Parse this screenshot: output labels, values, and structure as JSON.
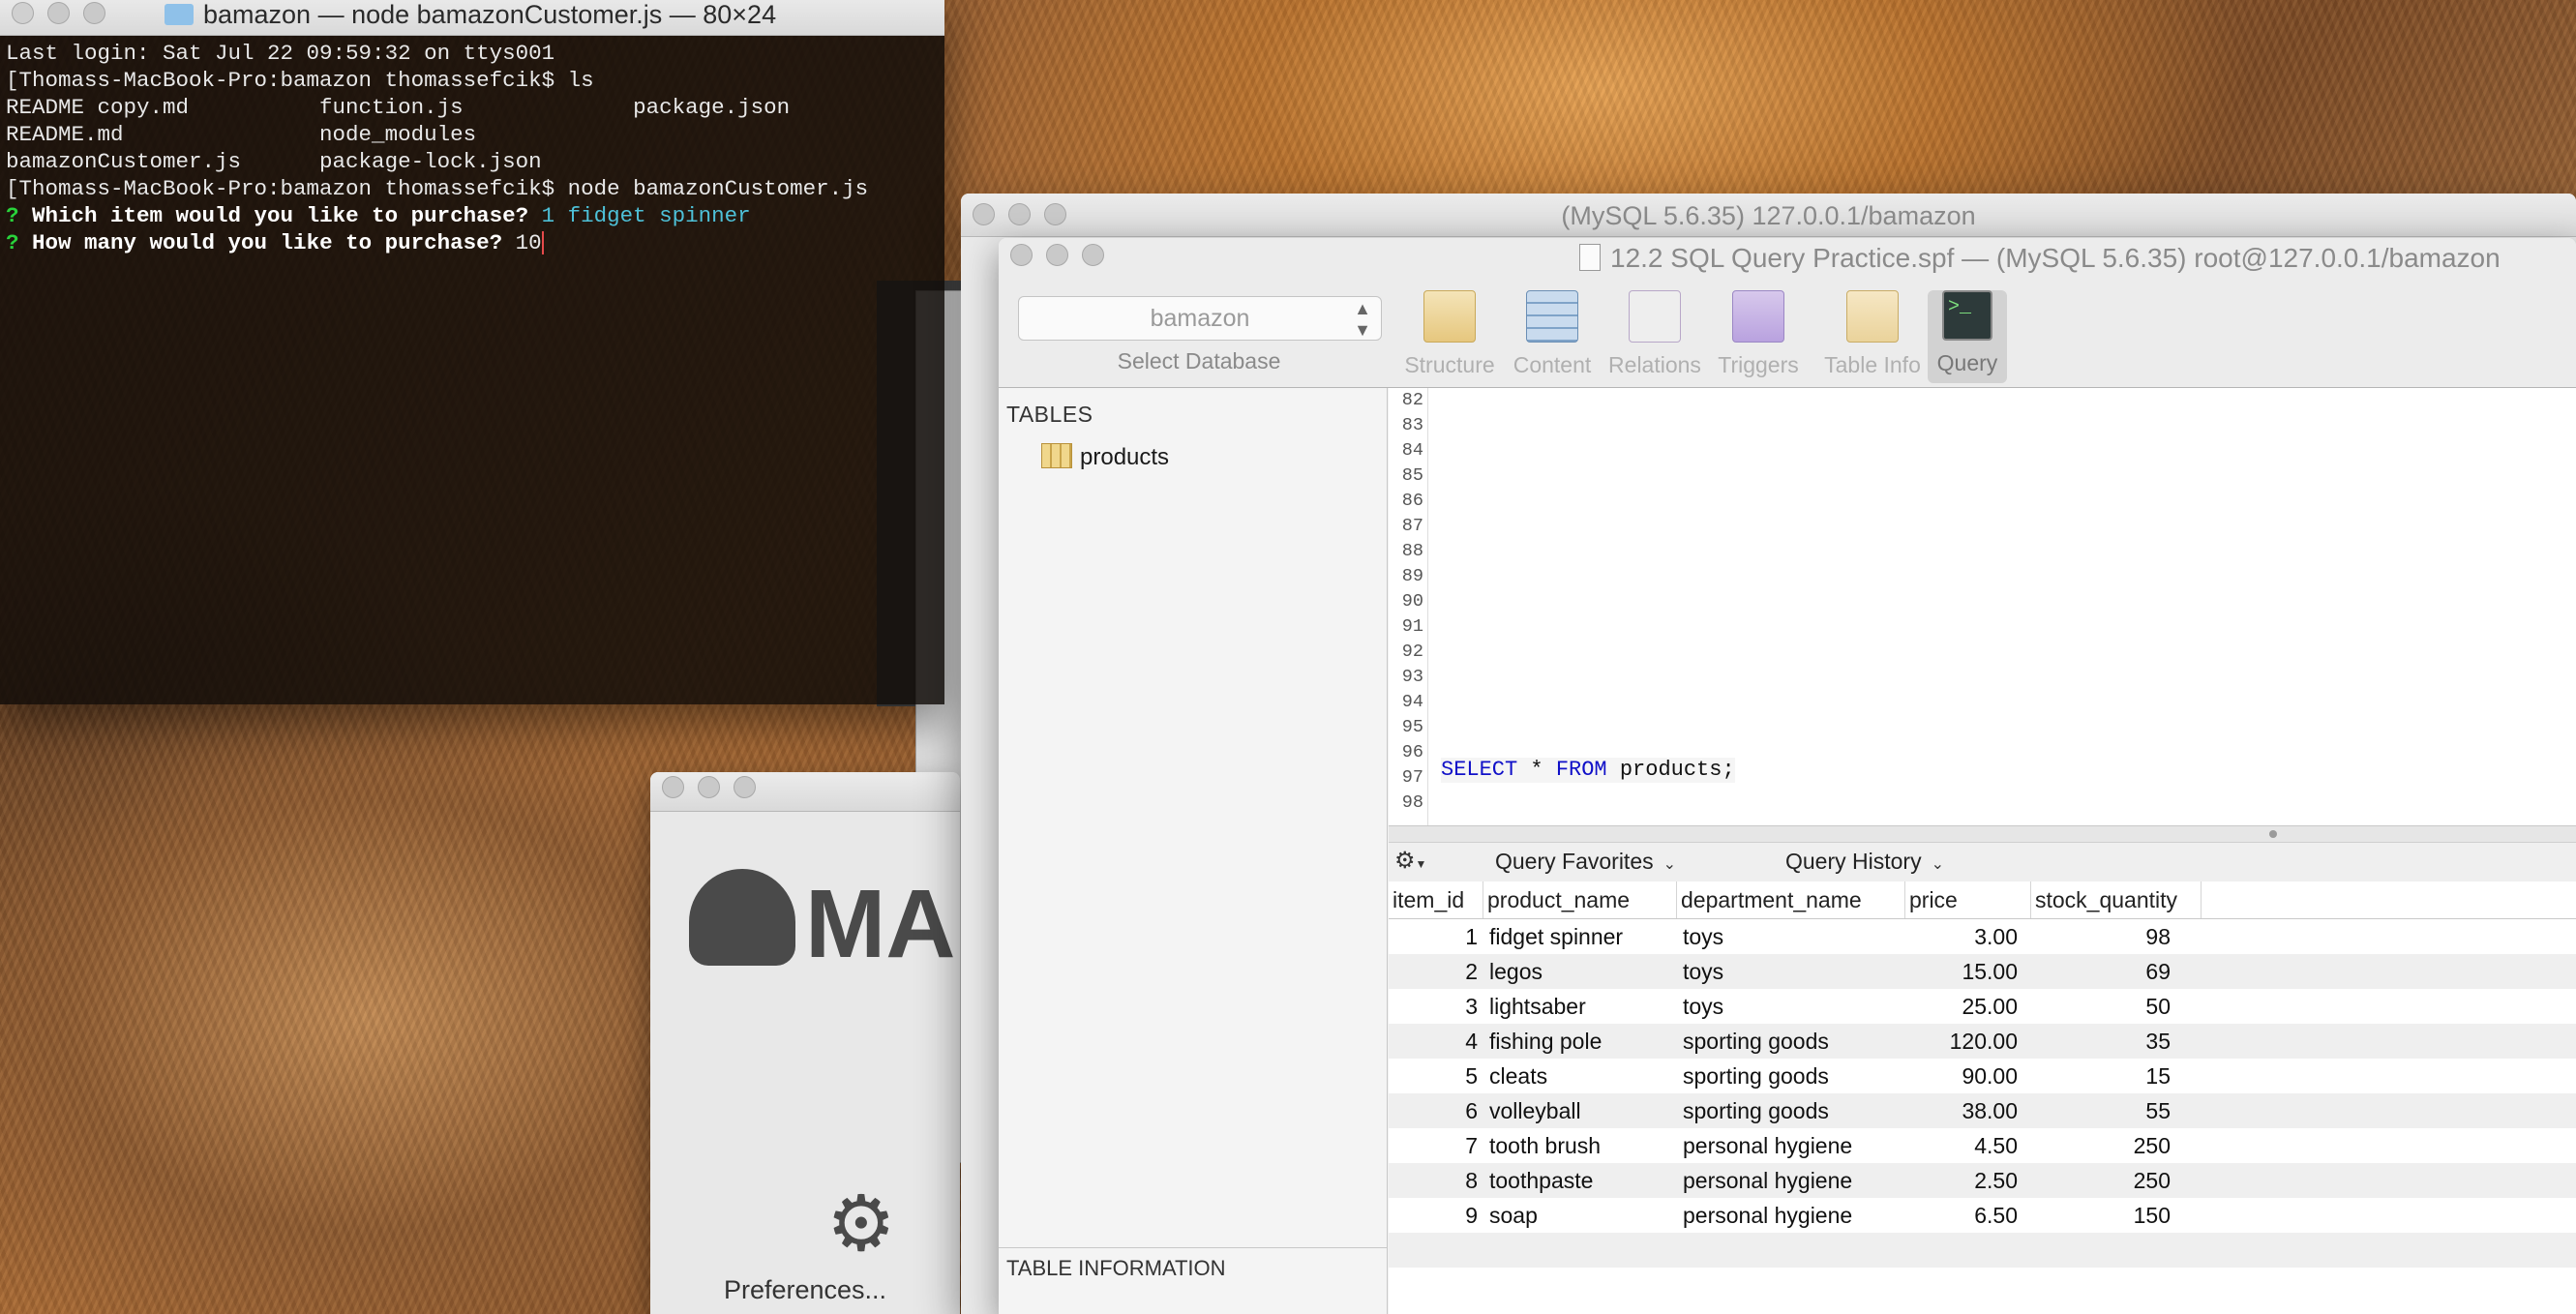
{
  "terminal": {
    "title": "bamazon — node bamazonCustomer.js — 80×24",
    "lines": {
      "l1": "Last login: Sat Jul 22 09:59:32 on ttys001",
      "l2": "[Thomass-MacBook-Pro:bamazon thomassefcik$ ls",
      "l3": "README copy.md          function.js             package.json",
      "l4": "README.md               node_modules",
      "l5": "bamazonCustomer.js      package-lock.json",
      "l6": "[Thomass-MacBook-Pro:bamazon thomassefcik$ node bamazonCustomer.js"
    },
    "q1_mark": "?",
    "q1_text": " Which item would you like to purchase? ",
    "q1_answer": "1 fidget spinner",
    "q2_mark": "?",
    "q2_text": " How many would you like to purchase? ",
    "q2_answer": "10"
  },
  "mamp": {
    "logo_text": "MA",
    "preferences_label": "Preferences..."
  },
  "sequel_back": {
    "title": "(MySQL 5.6.35) 127.0.0.1/bamazon"
  },
  "sequel": {
    "title": "12.2 SQL Query Practice.spf — (MySQL 5.6.35) root@127.0.0.1/bamazon",
    "database": "bamazon",
    "database_caption": "Select Database",
    "toolbar": [
      {
        "label": "Structure"
      },
      {
        "label": "Content"
      },
      {
        "label": "Relations"
      },
      {
        "label": "Triggers"
      },
      {
        "label": "Table Info"
      },
      {
        "label": "Query"
      }
    ],
    "tables_header": "TABLES",
    "table_item": "products",
    "table_info_header": "TABLE INFORMATION",
    "line_numbers": [
      "82",
      "83",
      "84",
      "85",
      "86",
      "87",
      "88",
      "89",
      "90",
      "91",
      "92",
      "93",
      "94",
      "95",
      "96",
      "97",
      "98"
    ],
    "query": {
      "kw1": "SELECT",
      "mid": " * ",
      "kw2": "FROM",
      "rest": " products;"
    },
    "query_favorites": "Query Favorites",
    "query_history": "Query History",
    "columns": [
      "item_id",
      "product_name",
      "department_name",
      "price",
      "stock_quantity"
    ],
    "rows": [
      [
        "1",
        "fidget spinner",
        "toys",
        "3.00",
        "98"
      ],
      [
        "2",
        "legos",
        "toys",
        "15.00",
        "69"
      ],
      [
        "3",
        "lightsaber",
        "toys",
        "25.00",
        "50"
      ],
      [
        "4",
        "fishing pole",
        "sporting goods",
        "120.00",
        "35"
      ],
      [
        "5",
        "cleats",
        "sporting goods",
        "90.00",
        "15"
      ],
      [
        "6",
        "volleyball",
        "sporting goods",
        "38.00",
        "55"
      ],
      [
        "7",
        "tooth brush",
        "personal hygiene",
        "4.50",
        "250"
      ],
      [
        "8",
        "toothpaste",
        "personal hygiene",
        "2.50",
        "250"
      ],
      [
        "9",
        "soap",
        "personal hygiene",
        "6.50",
        "150"
      ]
    ]
  }
}
